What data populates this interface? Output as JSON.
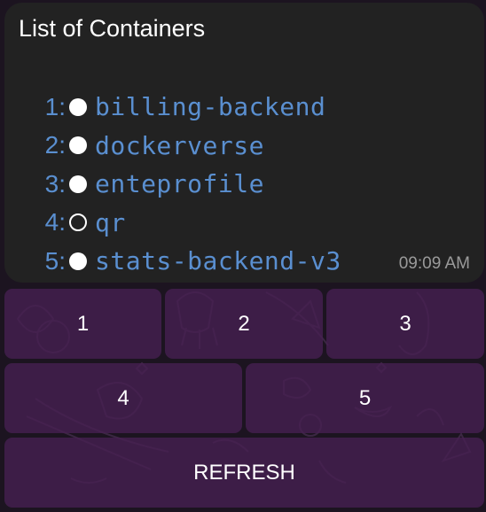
{
  "message": {
    "title": "List of Containers",
    "containers": [
      {
        "num": "1:",
        "name": "billing-backend",
        "status": "running"
      },
      {
        "num": "2:",
        "name": "dockerverse",
        "status": "running"
      },
      {
        "num": "3:",
        "name": "enteprofile",
        "status": "running"
      },
      {
        "num": "4:",
        "name": "qr",
        "status": "stopped"
      },
      {
        "num": "5:",
        "name": "stats-backend-v3",
        "status": "running"
      }
    ],
    "time": "09:09 AM"
  },
  "keyboard": {
    "row1": [
      "1",
      "2",
      "3"
    ],
    "row2": [
      "4",
      "5"
    ],
    "refresh_label": "REFRESH"
  },
  "colors": {
    "link": "#5a8fd0",
    "bubble": "#222222",
    "button": "#462052",
    "background": "#1c1420"
  }
}
